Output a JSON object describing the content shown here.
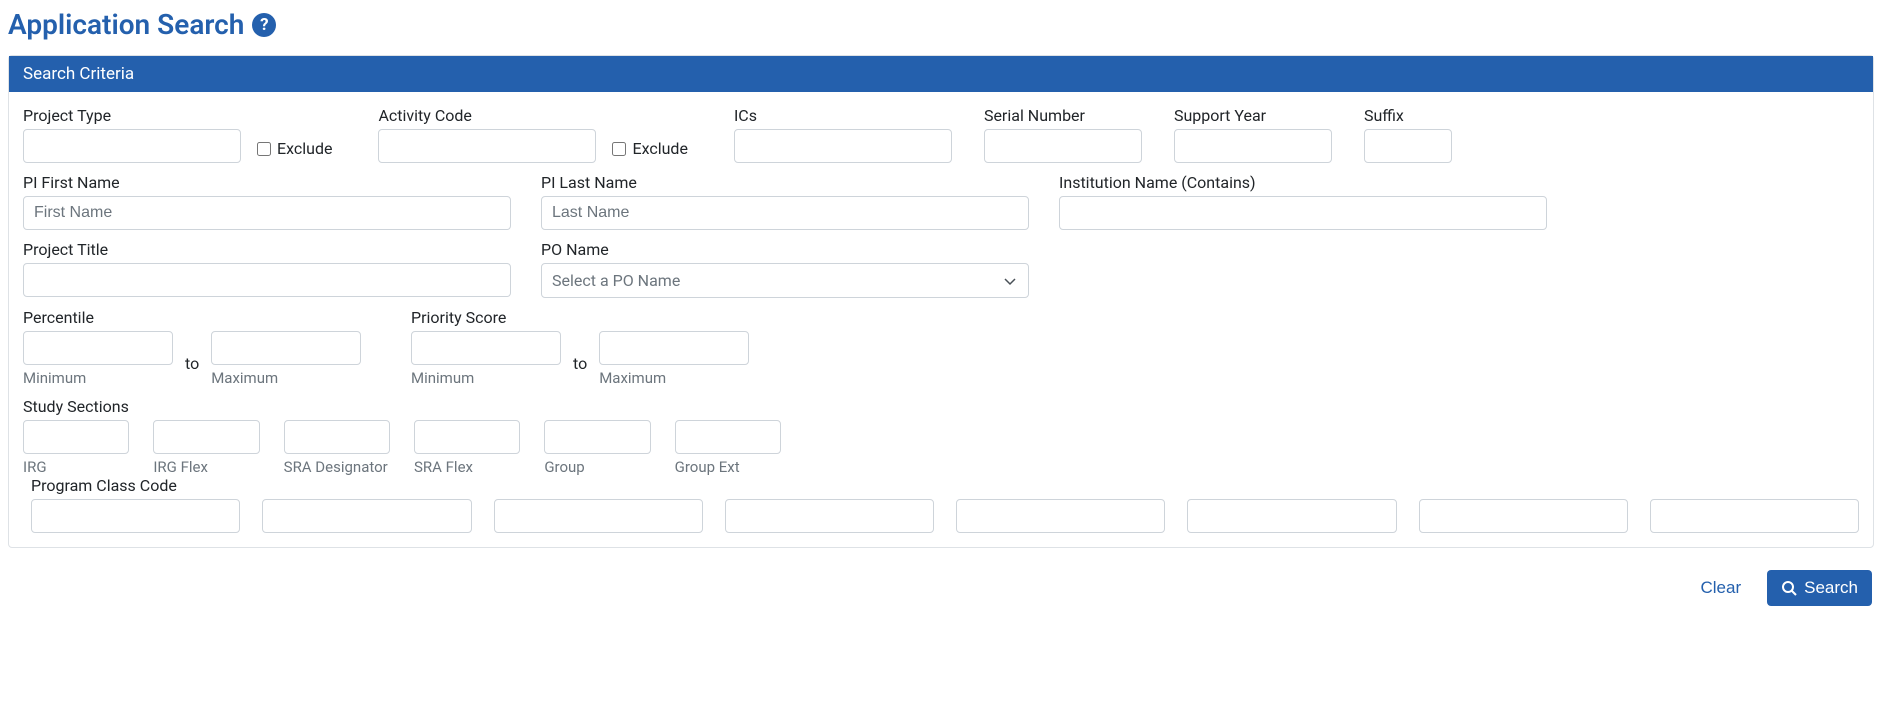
{
  "title": "Application Search",
  "panel_header": "Search Criteria",
  "labels": {
    "project_type": "Project Type",
    "exclude": "Exclude",
    "activity_code": "Activity Code",
    "ics": "ICs",
    "serial_number": "Serial Number",
    "support_year": "Support Year",
    "suffix": "Suffix",
    "pi_first": "PI First Name",
    "pi_last": "PI Last Name",
    "institution": "Institution Name (Contains)",
    "project_title": "Project Title",
    "po_name": "PO Name",
    "percentile": "Percentile",
    "priority_score": "Priority Score",
    "to": "to",
    "minimum": "Minimum",
    "maximum": "Maximum",
    "study_sections": "Study Sections",
    "program_class_code": "Program Class Code",
    "ss": {
      "irg": "IRG",
      "irg_flex": "IRG Flex",
      "sra_designator": "SRA Designator",
      "sra_flex": "SRA Flex",
      "group": "Group",
      "group_ext": "Group Ext"
    }
  },
  "placeholders": {
    "first_name": "First Name",
    "last_name": "Last Name",
    "po_name": "Select a PO Name"
  },
  "buttons": {
    "clear": "Clear",
    "search": "Search"
  }
}
